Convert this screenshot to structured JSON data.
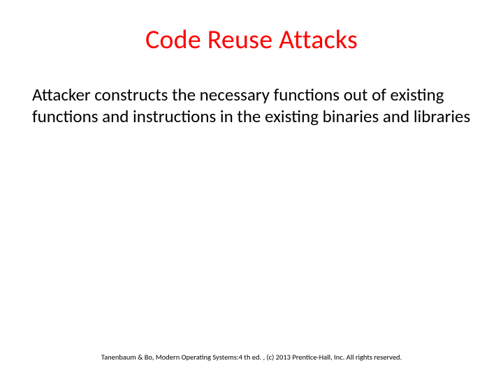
{
  "slide": {
    "title": "Code Reuse Attacks",
    "body": "Attacker constructs the necessary functions out of existing functions and instructions in the existing binaries and libraries",
    "footer": "Tanenbaum & Bo, Modern Operating Systems:4 th ed. , (c) 2013 Prentice-Hall, Inc. All rights reserved."
  }
}
